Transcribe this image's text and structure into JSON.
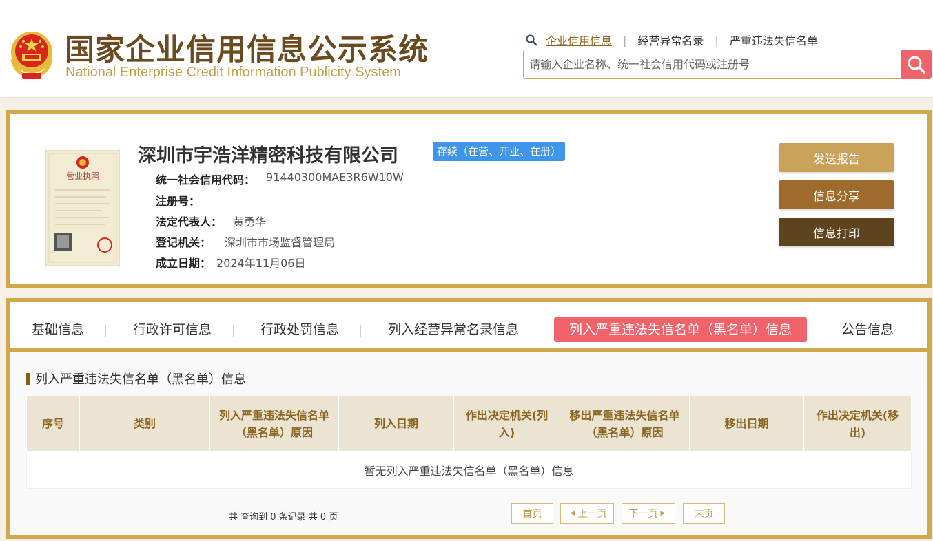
{
  "header": {
    "title_cn": "国家企业信用信息公示系统",
    "title_en": "National Enterprise Credit Information Publicity System",
    "nav": [
      {
        "label": "企业信用信息",
        "active": true
      },
      {
        "label": "经营异常名录",
        "active": false
      },
      {
        "label": "严重违法失信名单",
        "active": false
      }
    ],
    "search_placeholder": "请输入企业名称、统一社会信用代码或注册号",
    "search_icon": "search-icon"
  },
  "company": {
    "name": "深圳市宇浩洋精密科技有限公司",
    "status": "存续（在营、开业、在册）",
    "license_title": "营业执照",
    "fields": [
      {
        "key": "统一社会信用代码：",
        "value": "91440300MAE3R6W10W"
      },
      {
        "key": "注册号：",
        "value": ""
      },
      {
        "key": "法定代表人：",
        "value": "黄勇华"
      },
      {
        "key": "登记机关：",
        "value": "深圳市市场监督管理局"
      },
      {
        "key": "成立日期：",
        "value": "2024年11月06日"
      }
    ],
    "buttons": [
      {
        "label": "发送报告",
        "color": "#c9a159"
      },
      {
        "label": "信息分享",
        "color": "#9e6b2c"
      },
      {
        "label": "信息打印",
        "color": "#5e441d"
      }
    ]
  },
  "tabs": [
    {
      "label": "基础信息",
      "active": false
    },
    {
      "label": "行政许可信息",
      "active": false
    },
    {
      "label": "行政处罚信息",
      "active": false
    },
    {
      "label": "列入经营异常名录信息",
      "active": false
    },
    {
      "label": "列入严重违法失信名单（黑名单）信息",
      "active": true
    },
    {
      "label": "公告信息",
      "active": false
    }
  ],
  "section": {
    "title": "列入严重违法失信名单（黑名单）信息",
    "columns": [
      "序号",
      "类别",
      "列入严重违法失信名单（黑名单）原因",
      "列入日期",
      "作出决定机关(列入)",
      "移出严重违法失信名单（黑名单）原因",
      "移出日期",
      "作出决定机关(移出)"
    ],
    "empty_text": "暂无列入严重违法失信名单（黑名单）信息"
  },
  "pagination": {
    "total_text": "共 查询到 0 条记录 共 0 页",
    "first": "首页",
    "prev": "上一页",
    "next": "下一页",
    "last": "末页"
  },
  "colors": {
    "accent_gold": "#d2a84c",
    "active_tab": "#f0636a",
    "status_badge": "#3f96e8",
    "title_brown": "#6b4a1f"
  }
}
